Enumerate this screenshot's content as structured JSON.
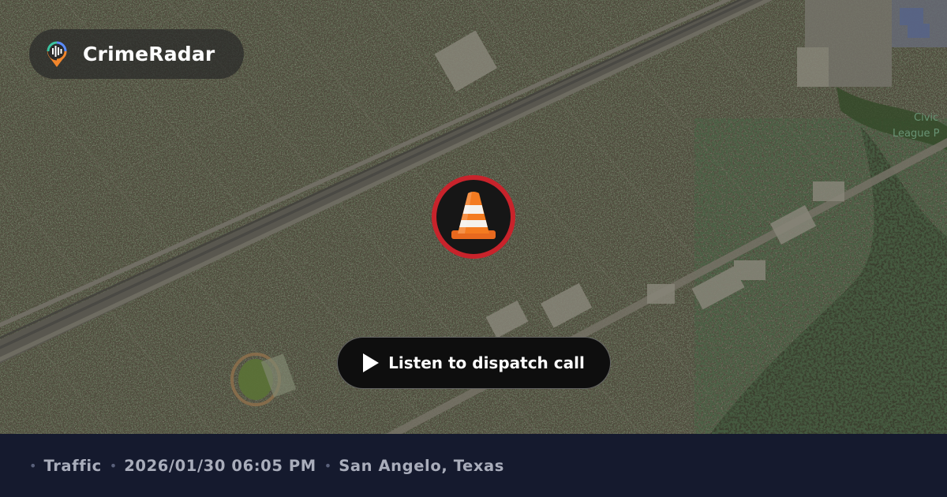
{
  "brand": {
    "name": "CrimeRadar",
    "logo_icon": "radar-pin-icon"
  },
  "incident": {
    "icon": "traffic-cone-icon",
    "ring_color": "#c8232b"
  },
  "dispatch": {
    "label": "Listen to dispatch call",
    "icon": "play-icon"
  },
  "map": {
    "park_label_line1": "Civic",
    "park_label_line2": "League P"
  },
  "footer": {
    "category": "Traffic",
    "datetime": "2026/01/30 06:05 PM",
    "location": "San Angelo, Texas",
    "separator": "•"
  },
  "colors": {
    "footer_bg": "#151a2e",
    "footer_text": "#a9adbb",
    "accent": "#c8232b"
  }
}
